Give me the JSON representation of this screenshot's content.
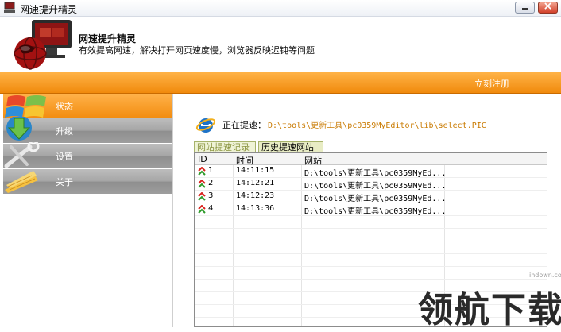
{
  "window": {
    "title": "网速提升精灵"
  },
  "header": {
    "app_name": "网速提升精灵",
    "description": "有效提高网速，解决打开网页速度慢，浏览器反映迟钝等问题"
  },
  "toolbar": {
    "register_label": "立刻注册"
  },
  "sidebar": {
    "items": [
      {
        "label": "状态",
        "active": true,
        "icon": "windows-logo-icon"
      },
      {
        "label": "升级",
        "active": false,
        "icon": "download-arrow-icon"
      },
      {
        "label": "设置",
        "active": false,
        "icon": "wrench-icon"
      },
      {
        "label": "关于",
        "active": false,
        "icon": "info-book-icon"
      }
    ]
  },
  "main": {
    "speed_label": "正在提速：",
    "speed_path": "D:\\tools\\更新工具\\pc0359MyEditor\\lib\\select.PIC",
    "tabs": [
      {
        "label": "网站提速记录"
      },
      {
        "label": "历史提速网站"
      }
    ],
    "table": {
      "columns": [
        "ID",
        "时间",
        "网站"
      ],
      "rows": [
        {
          "id": "1",
          "time": "14:11:15",
          "site": "D:\\tools\\更新工具\\pc0359MyEd..."
        },
        {
          "id": "2",
          "time": "14:12:21",
          "site": "D:\\tools\\更新工具\\pc0359MyEd..."
        },
        {
          "id": "3",
          "time": "14:12:23",
          "site": "D:\\tools\\更新工具\\pc0359MyEd..."
        },
        {
          "id": "4",
          "time": "14:13:36",
          "site": "D:\\tools\\更新工具\\pc0359MyEd..."
        }
      ]
    }
  },
  "watermark": {
    "domain": "ihdown.com",
    "text": "领航下载"
  },
  "colors": {
    "accent": "#f39417",
    "path_text": "#c97a00",
    "tab_border": "#a7b36b"
  }
}
